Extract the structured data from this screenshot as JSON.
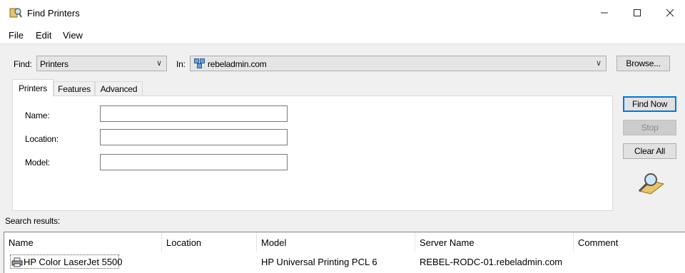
{
  "window": {
    "title": "Find Printers"
  },
  "menu": [
    "File",
    "Edit",
    "View"
  ],
  "find": {
    "label": "Find:",
    "value": "Printers"
  },
  "in": {
    "label": "In:",
    "value": "rebeladmin.com"
  },
  "browse_label": "Browse...",
  "tabs": [
    "Printers",
    "Features",
    "Advanced"
  ],
  "fields": {
    "name_label": "Name:",
    "location_label": "Location:",
    "model_label": "Model:",
    "name_value": "",
    "location_value": "",
    "model_value": ""
  },
  "actions": {
    "find_now": "Find Now",
    "stop": "Stop",
    "clear_all": "Clear All"
  },
  "search_results_label": "Search results:",
  "results": {
    "columns": [
      "Name",
      "Location",
      "Model",
      "Server Name",
      "Comment"
    ],
    "rows": [
      {
        "name": "HP Color LaserJet 5500",
        "location": "",
        "model": "HP Universal Printing PCL 6",
        "server": "REBEL-RODC-01.rebeladmin.com",
        "comment": ""
      }
    ]
  },
  "colors": {
    "accent": "#0078d7",
    "window_bg": "#f0f0f0"
  }
}
